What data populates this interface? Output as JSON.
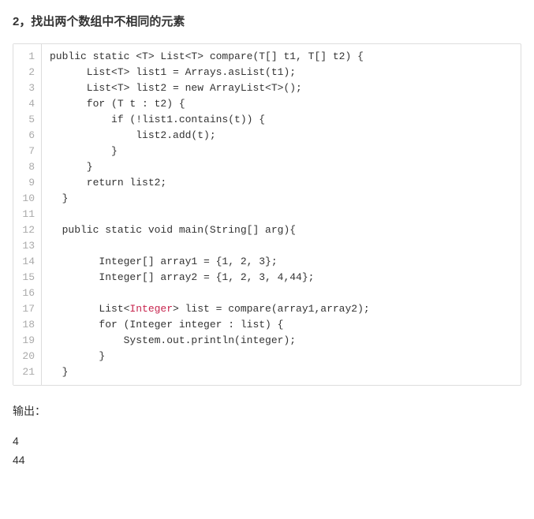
{
  "heading": "2，找出两个数组中不相同的元素",
  "code_lines": [
    {
      "n": "1",
      "segs": [
        {
          "t": "public static <T> List<T> compare(T[] t1, T[] t2) {"
        }
      ]
    },
    {
      "n": "2",
      "segs": [
        {
          "t": "      List<T> list1 = Arrays.asList(t1);"
        }
      ]
    },
    {
      "n": "3",
      "segs": [
        {
          "t": "      List<T> list2 = new ArrayList<T>();"
        }
      ]
    },
    {
      "n": "4",
      "segs": [
        {
          "t": "      for (T t : t2) {"
        }
      ]
    },
    {
      "n": "5",
      "segs": [
        {
          "t": "          if (!list1.contains(t)) {"
        }
      ]
    },
    {
      "n": "6",
      "segs": [
        {
          "t": "              list2.add(t);"
        }
      ]
    },
    {
      "n": "7",
      "segs": [
        {
          "t": "          }"
        }
      ]
    },
    {
      "n": "8",
      "segs": [
        {
          "t": "      }"
        }
      ]
    },
    {
      "n": "9",
      "segs": [
        {
          "t": "      return list2;"
        }
      ]
    },
    {
      "n": "10",
      "segs": [
        {
          "t": "  }"
        }
      ]
    },
    {
      "n": "11",
      "segs": [
        {
          "t": ""
        }
      ]
    },
    {
      "n": "12",
      "segs": [
        {
          "t": "  public static void main(String[] arg){"
        }
      ]
    },
    {
      "n": "13",
      "segs": [
        {
          "t": ""
        }
      ]
    },
    {
      "n": "14",
      "segs": [
        {
          "t": "        Integer[] array1 = {1, 2, 3};"
        }
      ]
    },
    {
      "n": "15",
      "segs": [
        {
          "t": "        Integer[] array2 = {1, 2, 3, 4,44};"
        }
      ]
    },
    {
      "n": "16",
      "segs": [
        {
          "t": ""
        }
      ]
    },
    {
      "n": "17",
      "segs": [
        {
          "t": "        List<"
        },
        {
          "t": "Integer",
          "cls": "k-type"
        },
        {
          "t": "> list = compare(array1,array2);"
        }
      ]
    },
    {
      "n": "18",
      "segs": [
        {
          "t": "        for (Integer integer : list) {"
        }
      ]
    },
    {
      "n": "19",
      "segs": [
        {
          "t": "            System.out.println(integer);"
        }
      ]
    },
    {
      "n": "20",
      "segs": [
        {
          "t": "        }"
        }
      ]
    },
    {
      "n": "21",
      "segs": [
        {
          "t": "  }"
        }
      ]
    }
  ],
  "output_label": "输出：",
  "output_values": [
    "4",
    "44"
  ]
}
